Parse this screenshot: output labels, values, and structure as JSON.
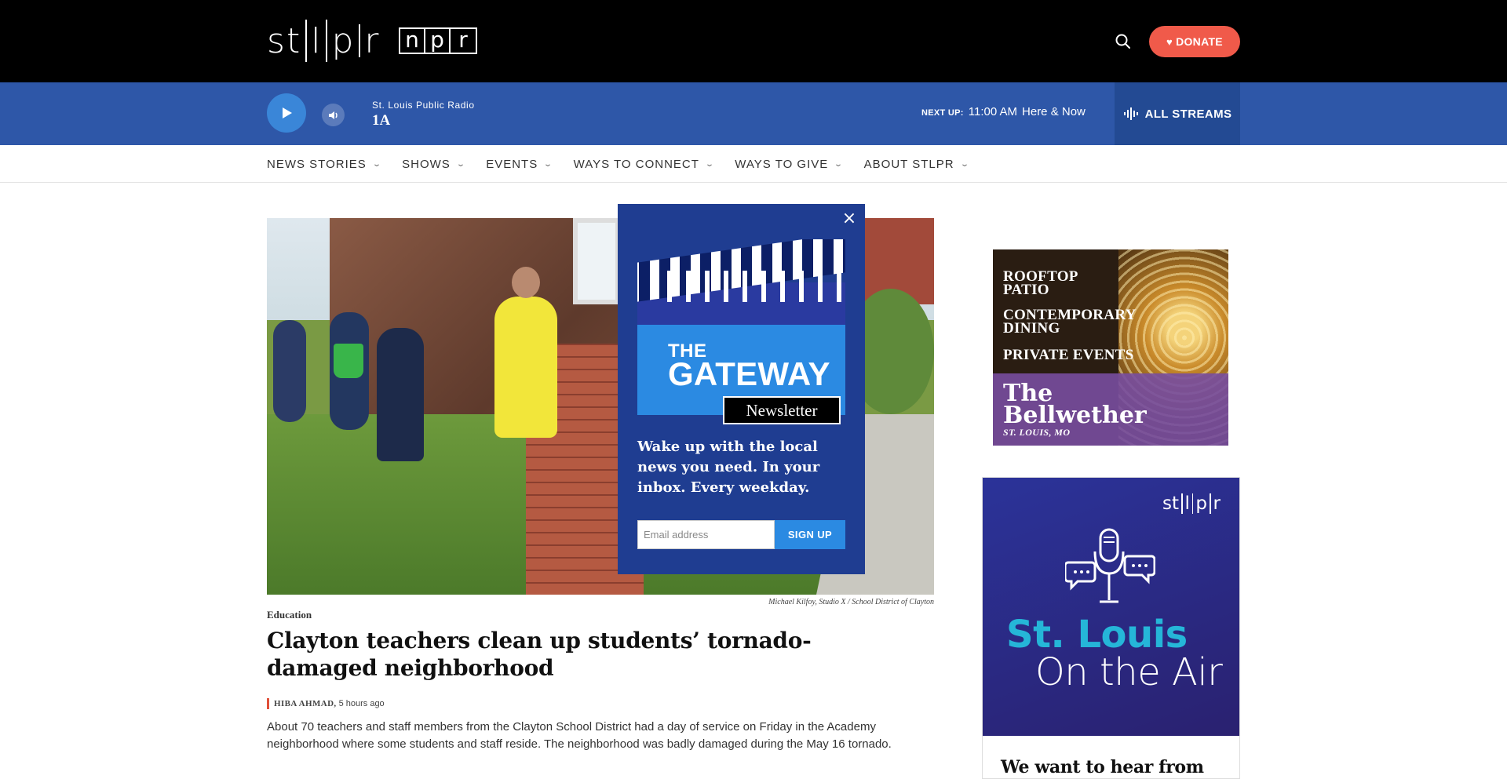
{
  "header": {
    "logo_text": "st|l|p|r",
    "npr_letters": [
      "n",
      "p",
      "r"
    ],
    "search_icon": "search-icon",
    "donate_label": "DONATE",
    "donate_color": "#f05a4a"
  },
  "player": {
    "station": "St. Louis Public Radio",
    "program": "1A",
    "next_up_label": "NEXT UP:",
    "next_up_time": "11:00 AM",
    "next_up_show": "Here & Now",
    "all_streams_label": "ALL STREAMS",
    "bar_color": "#2e57a8"
  },
  "nav": {
    "items": [
      {
        "label": "NEWS STORIES"
      },
      {
        "label": "SHOWS"
      },
      {
        "label": "EVENTS"
      },
      {
        "label": "WAYS TO CONNECT"
      },
      {
        "label": "WAYS TO GIVE"
      },
      {
        "label": "ABOUT STLPR"
      }
    ]
  },
  "article": {
    "photo_credit": "Michael Kilfoy, Studio X  /  School District of Clayton",
    "category": "Education",
    "headline": "Clayton teachers clean up students’ tornado-damaged neighborhood",
    "author": "HIBA AHMAD,",
    "time": "5 hours ago",
    "teaser": "About 70 teachers and staff members from the Clayton School District had a day of service on Friday in the Academy neighborhood where some students and staff reside. The neighborhood was badly damaged during the May 16 tornado."
  },
  "popup": {
    "gateway_the": "THE",
    "gateway_main": "GATEWAY",
    "newsletter_tag": "Newsletter",
    "pitch": "Wake up with the local news you need. In your inbox. Every weekday.",
    "email_placeholder": "Email address",
    "signup_label": "SIGN UP",
    "bg_color": "#1f3d91"
  },
  "ad_bellwether": {
    "line1": "ROOFTOP PATIO",
    "line2": "CONTEMPORARY DINING",
    "line3": "PRIVATE EVENTS",
    "brand_line1": "The",
    "brand_line2": "Bellwether",
    "location": "ST. LOUIS, MO"
  },
  "ad_on_the_air": {
    "logo": "st|l|p|r",
    "title1": "St. Louis",
    "title2": "On the Air",
    "hear": "We want to hear from you"
  }
}
